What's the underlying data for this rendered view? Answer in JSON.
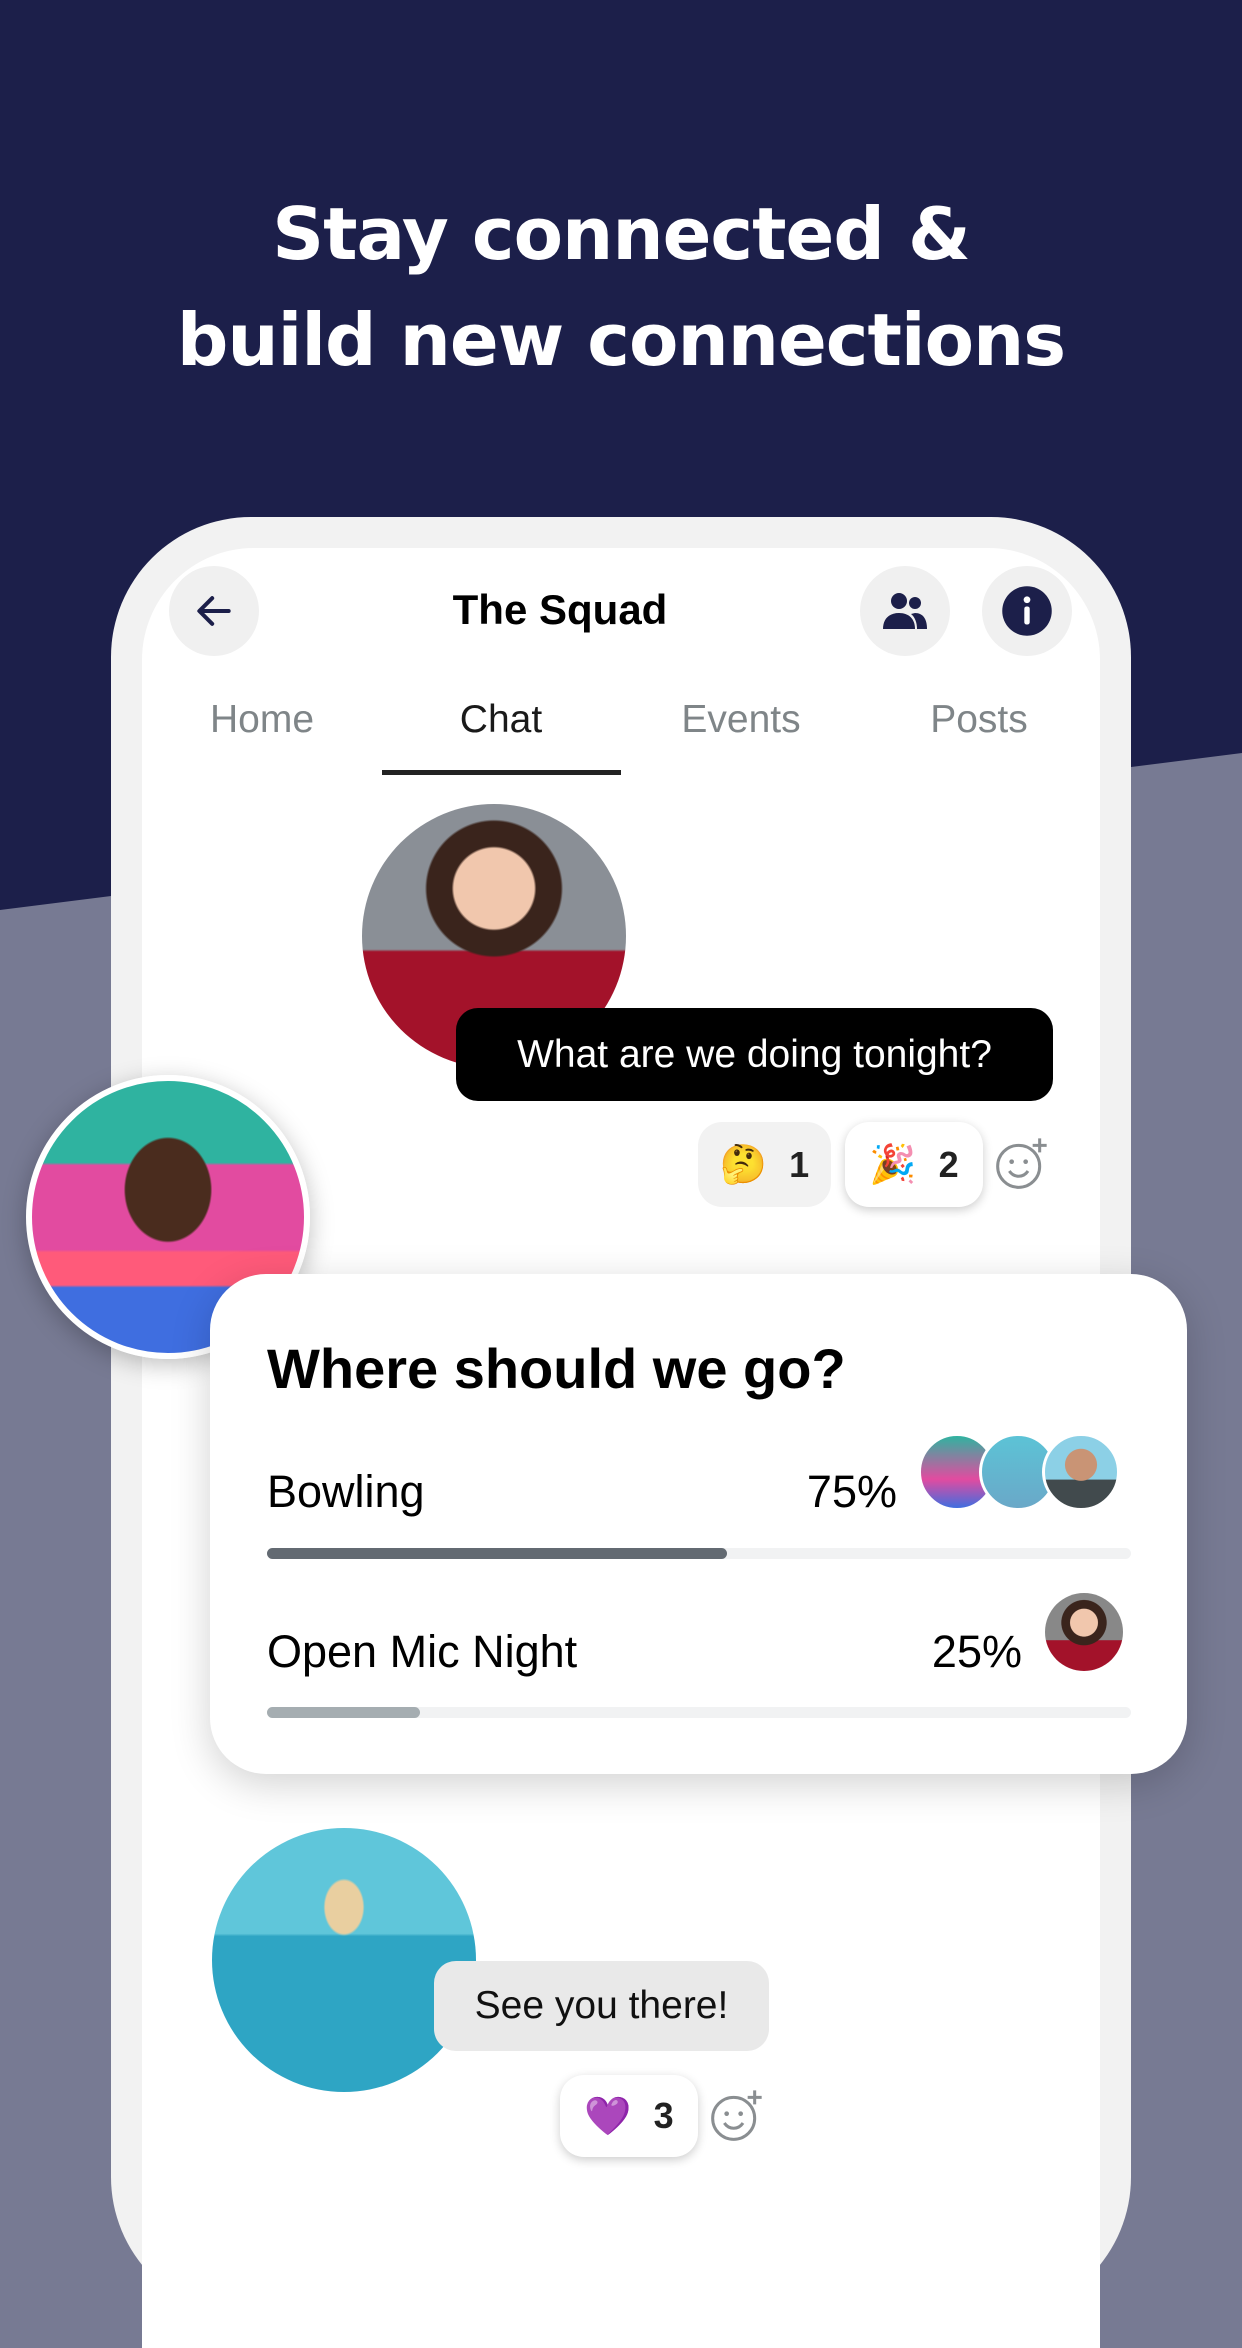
{
  "headline": {
    "line1": "Stay connected &",
    "line2": "build new connections"
  },
  "header": {
    "title": "The Squad",
    "back_icon": "arrow-left-icon",
    "members_icon": "people-icon",
    "info_icon": "info-icon"
  },
  "tabs": [
    {
      "label": "Home"
    },
    {
      "label": "Chat",
      "active": true
    },
    {
      "label": "Events"
    },
    {
      "label": "Posts"
    }
  ],
  "messages": [
    {
      "text": "What are we doing tonight?",
      "reactions": [
        {
          "emoji": "🤔",
          "count": "1"
        },
        {
          "emoji": "🎉",
          "count": "2",
          "selected": true
        }
      ]
    },
    {
      "text": "See you there!",
      "reactions": [
        {
          "emoji": "💜",
          "count": "3",
          "selected": true
        }
      ]
    }
  ],
  "poll": {
    "question": "Where should we go?",
    "options": [
      {
        "label": "Bowling",
        "percent_label": "75%",
        "percent": 75
      },
      {
        "label": "Open Mic Night",
        "percent_label": "25%",
        "percent": 25
      }
    ]
  },
  "colors": {
    "navy": "#1c1f4a",
    "slate": "#777a93",
    "bar_leading": "#636a72",
    "bar_other": "#a5adb1",
    "sent_bubble": "#000000",
    "received_bubble": "#e9e9e9"
  }
}
